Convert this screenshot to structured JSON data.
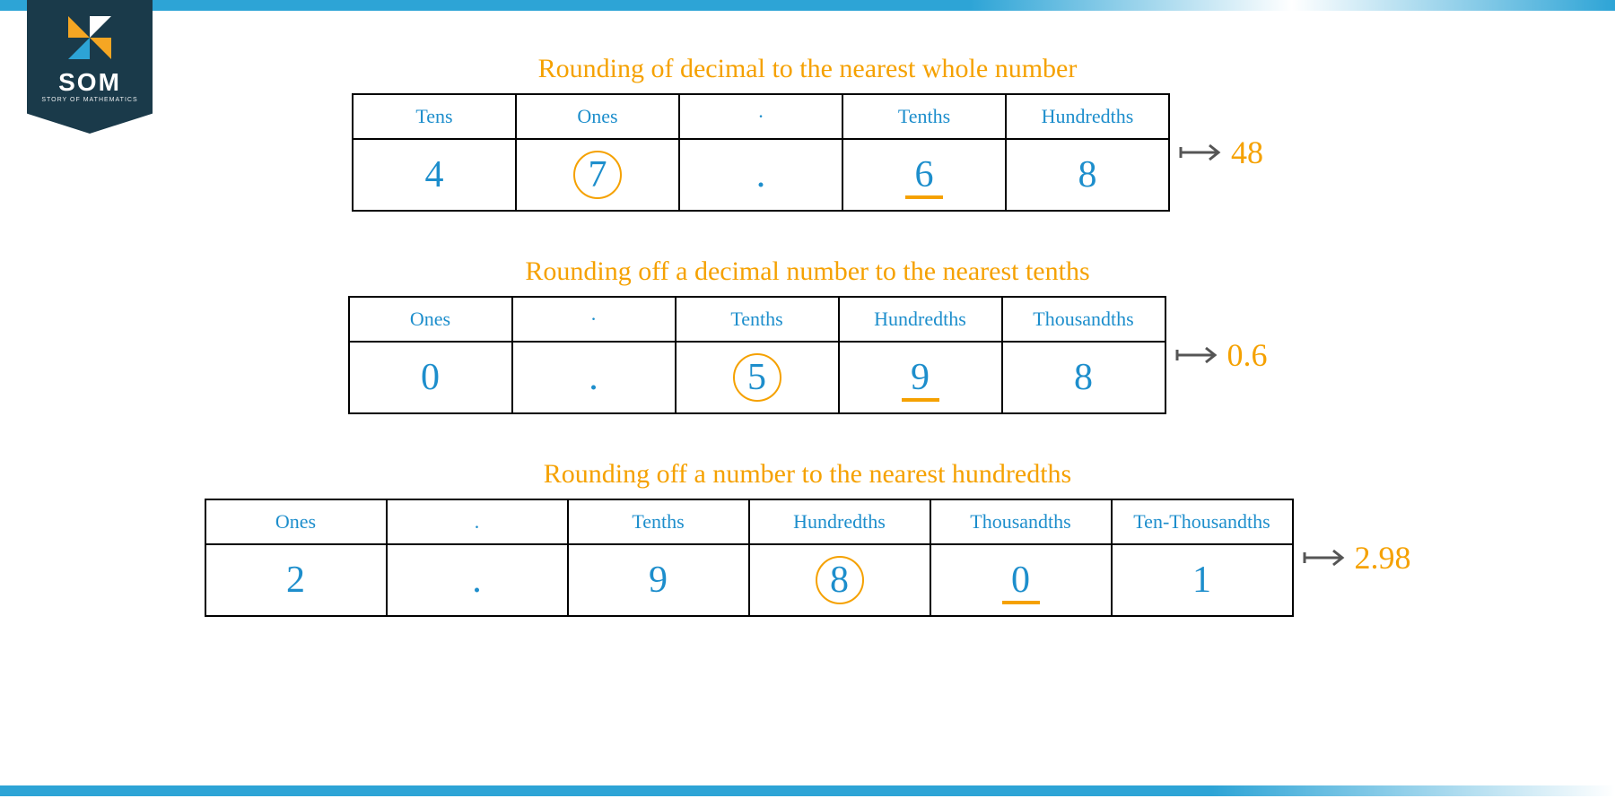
{
  "brand": {
    "name": "SOM",
    "tagline": "STORY OF MATHEMATICS"
  },
  "sections": [
    {
      "title": "Rounding of decimal to the nearest whole number",
      "col_width_class": "w1",
      "headers": [
        "Tens",
        "Ones",
        "·",
        "Tenths",
        "Hundredths"
      ],
      "digits": [
        "4",
        "7",
        ".",
        "6",
        "8"
      ],
      "circled_index": 1,
      "underlined_index": 3,
      "result": "48"
    },
    {
      "title": "Rounding off a decimal number to the nearest tenths",
      "col_width_class": "w1",
      "headers": [
        "Ones",
        "·",
        "Tenths",
        "Hundredths",
        "Thousandths"
      ],
      "digits": [
        "0",
        ".",
        "5",
        "9",
        "8"
      ],
      "circled_index": 2,
      "underlined_index": 3,
      "result": "0.6"
    },
    {
      "title": "Rounding off a number to the nearest hundredths",
      "col_width_class": "w2",
      "headers": [
        "Ones",
        ".",
        "Tenths",
        "Hundredths",
        "Thousandths",
        "Ten-Thousandths"
      ],
      "digits": [
        "2",
        ".",
        "9",
        "8",
        "0",
        "1"
      ],
      "circled_index": 3,
      "underlined_index": 4,
      "result": "2.98"
    }
  ],
  "chart_data": {
    "type": "table",
    "description": "Three place-value tables illustrating decimal rounding",
    "examples": [
      {
        "input": 47.68,
        "round_to": "whole number (ones)",
        "rounding_digit": 7,
        "decider_digit": 6,
        "result": 48
      },
      {
        "input": 0.598,
        "round_to": "tenths",
        "rounding_digit": 5,
        "decider_digit": 9,
        "result": 0.6
      },
      {
        "input": 2.9801,
        "round_to": "hundredths",
        "rounding_digit": 8,
        "decider_digit": 0,
        "result": 2.98
      }
    ]
  }
}
